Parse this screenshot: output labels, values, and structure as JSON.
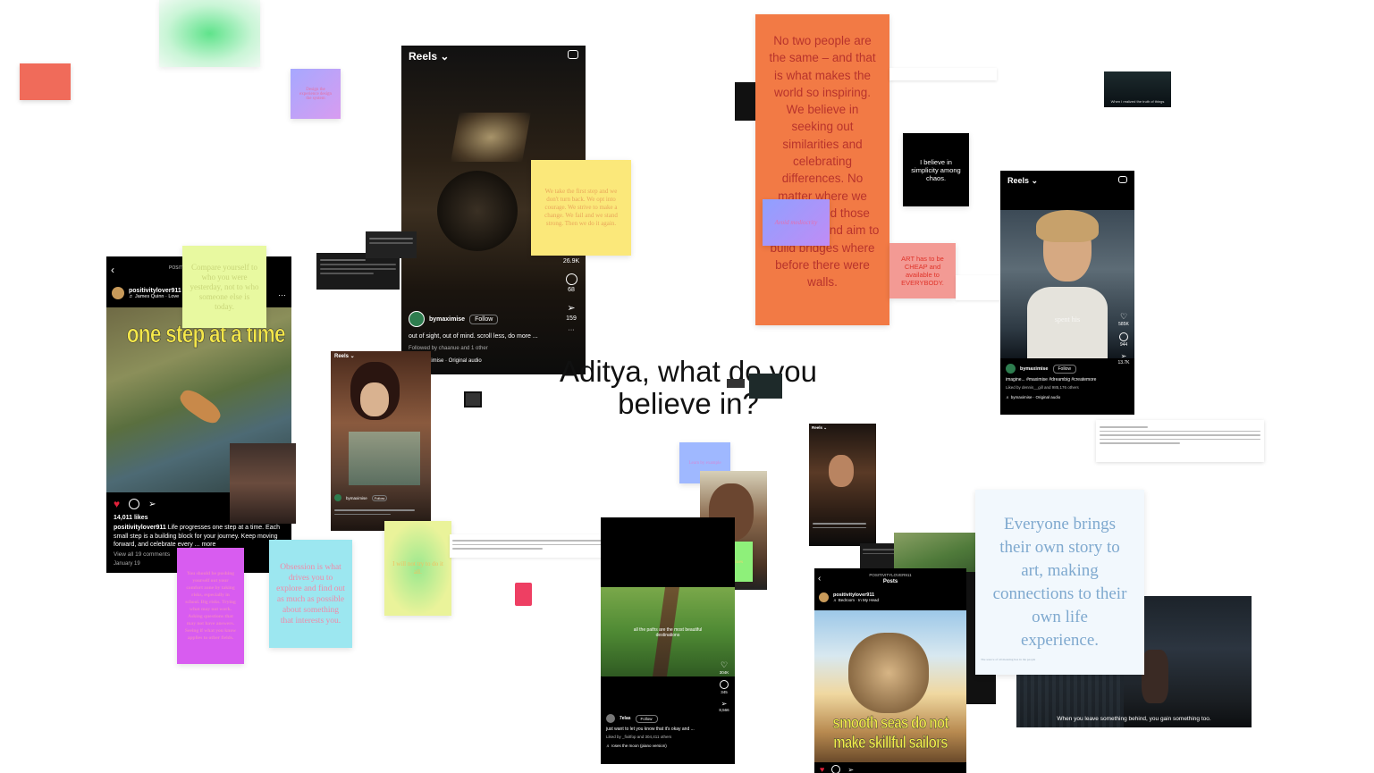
{
  "center": {
    "line1": "Aditya, what do you",
    "line2": "believe in?"
  },
  "notes": {
    "orange_big": "No two people are the same – and that is what makes the world so inspiring. We believe in seeking out similarities and celebrating differences. No matter where we seek to find those around us and aim to build bridges where before there were walls.",
    "yellow_top": "We take the first step and we don't turn back. We opt into courage. We strive to make a change. We fail and we stand strong. Then we do it again.",
    "green_compare": "Compare yourself to who you were yesterday, not to who someone else is today.",
    "purple_small": "Avoid mediocrity",
    "black_simplicity": "I believe in simplicity among chaos.",
    "red_art": "ART has to be CHEAP and available to EVERYBODY.",
    "magenta": "You should be pushing yourself out your comfort zone by taking risks, especially in school. Big risks. Trying what may not work. Asking questions that may not have answers. Seeing if what you know applies to other fields.",
    "cyan": "Obsession is what drives you to explore and find out as much as possible about something that interests you.",
    "yellowgreen": "I will not try to do it all.",
    "blue_small_mid": "Learn by example",
    "green_small_mid": "Let your values",
    "everyone": "Everyone brings their own story to art, making connections to their own life experience.",
    "lavender_tl": "Design the experience design the system",
    "everyone_footer": "The source of all meaning lies in the people"
  },
  "reels_main": {
    "header": "Reels ⌄",
    "likes": "26.9K",
    "comments": "68",
    "shares": "159",
    "user": "bymaximise",
    "follow": "Follow",
    "caption": "out of sight, out of mind. scroll less, do more ...",
    "followed": "Followed by chaanue and 1 other",
    "audio": "♬ bymaximise · Original audio"
  },
  "reels_right": {
    "header": "Reels ⌄",
    "overlay": "spent his",
    "likes": "585K",
    "comments": "944",
    "shares": "13.7K",
    "user": "bymaximise",
    "follow": "Follow",
    "caption": "imagine... #maximise #dreambig #createmore",
    "liked": "Liked by dennis__gill and 985,176 others",
    "audio": "♬ bymaximise · Original audio"
  },
  "post_left": {
    "header": "POSITIVITYLOVER911",
    "user": "positivitylover911",
    "audio": "♬ James Quinn · Love",
    "overlay": "one step at a time",
    "likes": "14,011 likes",
    "caption_user": "positivitylover911",
    "caption": "Life progresses one step at a time. Each small step is a building block for your journey. Keep moving forward, and celebrate every ... more",
    "comments": "View all 19 comments",
    "date": "January 19"
  },
  "post_cat": {
    "header": "POSITIVITYLOVER911",
    "sub": "Posts",
    "user": "positivitylover911",
    "audio": "♬ Bedroom · In My Head",
    "overlay1": "smooth seas do not",
    "overlay2": "make skillful sailors"
  },
  "reels_grass": {
    "overlay": "all the paths are the most beautiful destinations",
    "likes": "304K",
    "comments": "345",
    "shares": "8,566",
    "user": "7elas",
    "follow": "Follow",
    "caption": "just want to let you know that it's okay and ...",
    "liked": "Liked by _fixitfop and 304,411 others",
    "audio": "♬ roses the moon (piano version)"
  },
  "reels_girl": {
    "header": "Reels ⌄",
    "user": "bymaximise",
    "follow": "Follow"
  },
  "reels_man": {
    "header": "Reels ⌄"
  },
  "dark_video_caption": "When you leave something behind, you gain something too.",
  "small_video_caption": "When I realized the truth of things"
}
